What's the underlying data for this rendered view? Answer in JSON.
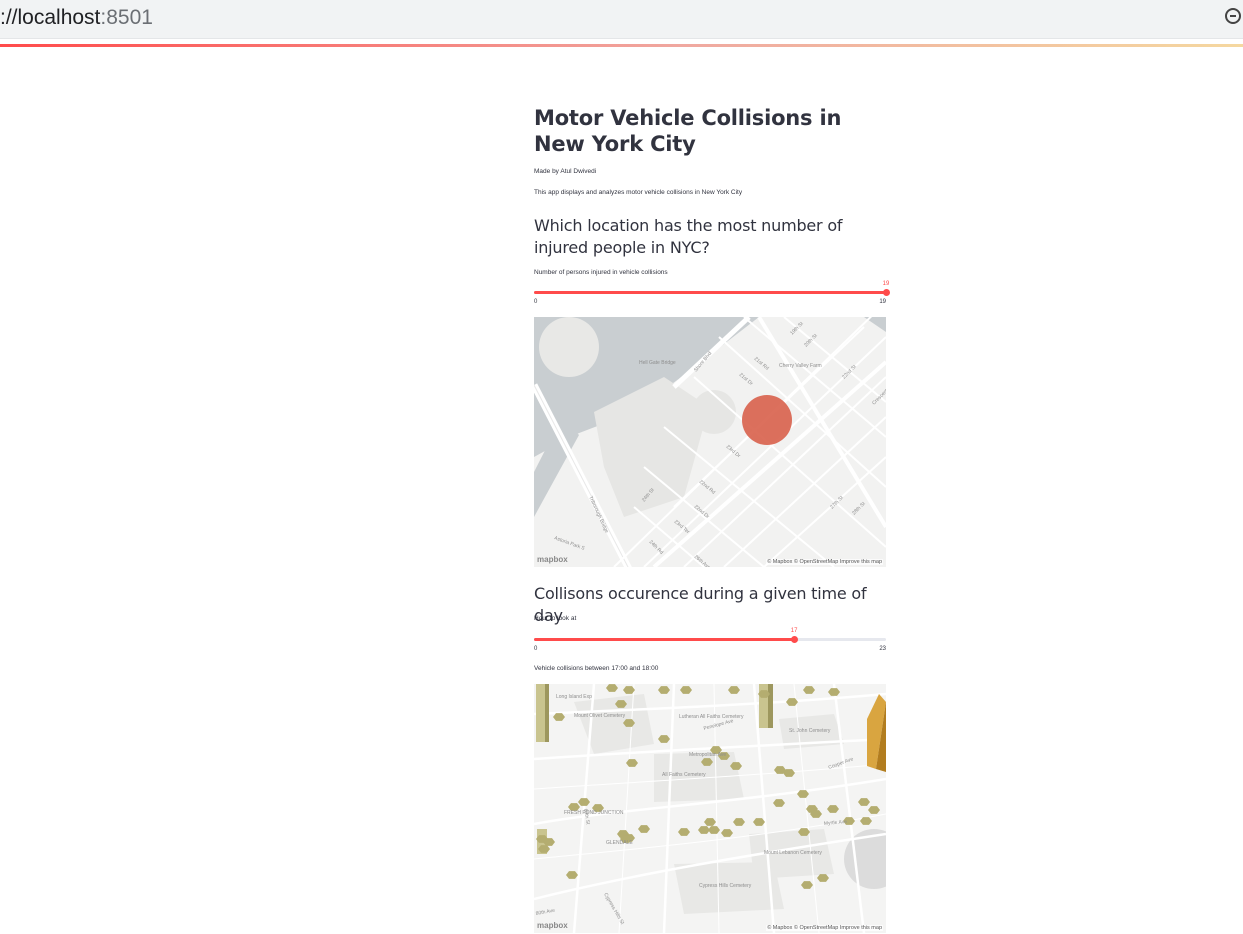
{
  "browser": {
    "url_scheme_fragment": "://localhost",
    "url_port": ":8501"
  },
  "app": {
    "title": "Motor Vehicle Collisions in New York City",
    "author": "Made by Atul Dwivedi",
    "description": "This app displays and analyzes motor vehicle collisions in New York City"
  },
  "section1": {
    "heading": "Which location has the most number of injured people in NYC?",
    "slider": {
      "label": "Number of persons injured in vehicle collisions",
      "min": "0",
      "max": "19",
      "value": "19",
      "fraction": 1.0
    },
    "map": {
      "labels": [
        "Hell Gate Bridge",
        "Shore Blvd",
        "21st Rd",
        "21st Dr",
        "Cherry Valley Farm",
        "19th St",
        "20th St",
        "22nd St",
        "23rd Dr",
        "22nd Rd",
        "22nd Dr",
        "23rd Ter",
        "24th St",
        "Triborough Bridge",
        "Astoria Park S",
        "24th Rd",
        "26th Ave",
        "27th St",
        "28th St",
        "Crescent"
      ],
      "attribution": "© Mapbox © OpenStreetMap Improve this map",
      "logo": "mapbox",
      "marker_color": "#d9644f"
    }
  },
  "section2": {
    "heading": "Collisons occurence during a given time of day",
    "slider": {
      "label": "Hour to look at",
      "min": "0",
      "max": "23",
      "value": "17",
      "fraction": 0.739
    },
    "caption": "Vehicle collisions between 17:00 and 18:00",
    "map": {
      "labels": [
        "Long Island Exp",
        "Mount Olivet Cemetery",
        "Lutheran All Faiths Cemetery",
        "All Faiths Cemetery",
        "St. John Cemetery",
        "Cooper Ave",
        "FRESH POND JUNCTION",
        "GLENDALE",
        "Mount Lebanon Cemetery",
        "Cypress Hills Cemetery",
        "Metropolitan Ave",
        "Penelope Ave",
        "80th Ave",
        "Cypress Hills St",
        "69th St",
        "Myrtle Ave"
      ],
      "attribution": "© Mapbox © OpenStreetMap Improve this map",
      "logo": "mapbox",
      "hex_color": "#b4ad70"
    }
  }
}
